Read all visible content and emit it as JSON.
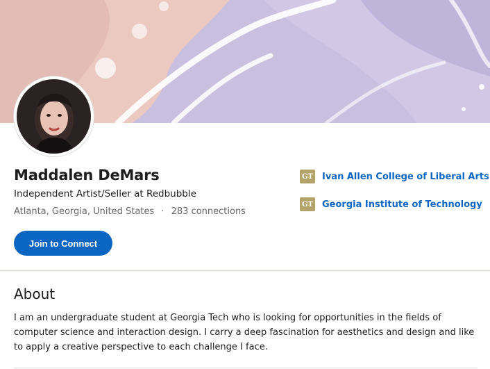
{
  "profile": {
    "name": "Maddalen DeMars",
    "headline": "Independent Artist/Seller at Redbubble",
    "location": "Atlanta, Georgia, United States",
    "separator": "·",
    "connections": "283 connections",
    "join_label": "Join to Connect"
  },
  "education": [
    {
      "name": "Ivan Allen College of Liberal Arts",
      "logo_text": "GT",
      "logo_icon": "georgia-tech-logo"
    },
    {
      "name": "Georgia Institute of Technology",
      "logo_text": "GT",
      "logo_icon": "georgia-tech-logo"
    }
  ],
  "about": {
    "title": "About",
    "text": "I am an undergraduate student at Georgia Tech who is looking for opportunities in the fields of computer science and interaction design. I carry a deep fascination for aesthetics and design and like to apply a creative perspective to each challenge I face."
  },
  "colors": {
    "accent": "#0a66c2",
    "cover_pink": "#e9c4bd",
    "cover_lavender": "#c8bfe0",
    "gt_gold": "#b3a369"
  }
}
